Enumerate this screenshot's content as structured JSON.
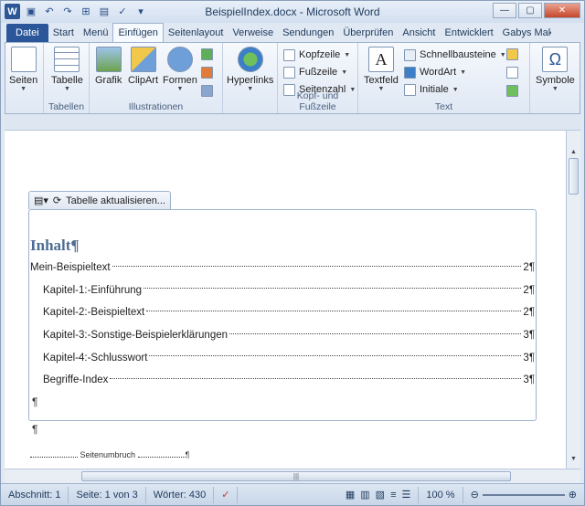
{
  "window": {
    "title": "BeispielIndex.docx - Microsoft Word"
  },
  "qat": [
    "save-icon",
    "undo-icon",
    "redo-icon",
    "format-painter-icon",
    "book-icon",
    "customize-icon"
  ],
  "window_controls": {
    "minimize": "—",
    "maximize": "▢",
    "close": "✕"
  },
  "tabs": [
    "Datei",
    "Start",
    "Menü",
    "Einfügen",
    "Seitenlayout",
    "Verweise",
    "Sendungen",
    "Überprüfen",
    "Ansicht",
    "Entwicklert",
    "Gabys Makros"
  ],
  "active_tab": "Einfügen",
  "ribbon": {
    "groups": [
      {
        "label": "",
        "buttons": [
          "Seiten"
        ]
      },
      {
        "label": "Tabellen",
        "buttons": [
          "Tabelle"
        ]
      },
      {
        "label": "Illustrationen",
        "buttons": [
          "Grafik",
          "ClipArt",
          "Formen"
        ]
      },
      {
        "label": "",
        "buttons": [
          "Hyperlinks"
        ]
      },
      {
        "label": "Kopf- und Fußzeile",
        "buttons": [
          "Kopfzeile",
          "Fußzeile",
          "Seitenzahl"
        ]
      },
      {
        "label": "Text",
        "buttons": [
          "Textfeld",
          "Schnellbausteine",
          "WordArt",
          "Initiale"
        ]
      },
      {
        "label": "",
        "buttons": [
          "Symbole"
        ]
      }
    ]
  },
  "toc_tool": {
    "update_label": "Tabelle aktualisieren..."
  },
  "document": {
    "heading": "Inhalt¶",
    "toc_entries": [
      {
        "text": "Mein-Beispieltext",
        "page": "2¶",
        "indent": 0
      },
      {
        "text": "Kapitel-1:-Einführung",
        "page": "2¶",
        "indent": 1
      },
      {
        "text": "Kapitel-2:-Beispieltext",
        "page": "2¶",
        "indent": 1
      },
      {
        "text": "Kapitel-3:-Sonstige-Beispielerklärungen",
        "page": "3¶",
        "indent": 1
      },
      {
        "text": "Kapitel-4:-Schlusswort",
        "page": "3¶",
        "indent": 1
      },
      {
        "text": "Begriffe-Index",
        "page": "3¶",
        "indent": 1
      }
    ],
    "pilcrow": "¶",
    "page_break": "Seitenumbruch"
  },
  "statusbar": {
    "section": "Abschnitt: 1",
    "page": "Seite: 1 von 3",
    "words": "Wörter: 430",
    "zoom": "100 %"
  }
}
